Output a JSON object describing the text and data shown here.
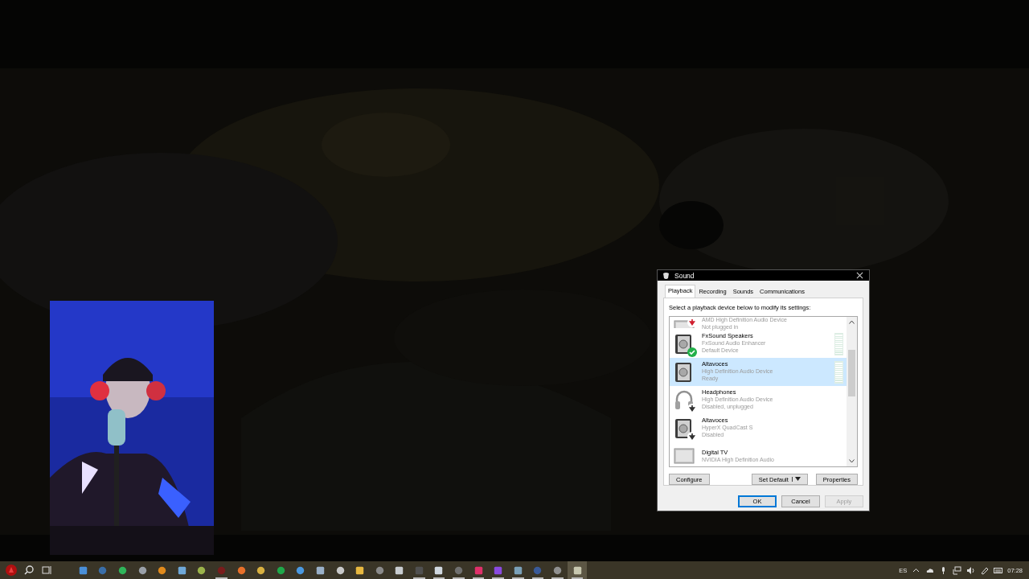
{
  "dialog": {
    "title": "Sound",
    "tabs": [
      {
        "label": "Playback",
        "selected": true
      },
      {
        "label": "Recording",
        "selected": false
      },
      {
        "label": "Sounds",
        "selected": false
      },
      {
        "label": "Communications",
        "selected": false
      }
    ],
    "instruction": "Select a playback device below to modify its settings:",
    "devices": [
      {
        "kind": "monitor",
        "description": "AMD High Definition Audio Device",
        "status": "Not plugged in",
        "is_default": false,
        "unplugged": true,
        "disabled": false,
        "selected": false,
        "meter": false
      },
      {
        "kind": "speaker",
        "name": "FxSound Speakers",
        "description": "FxSound Audio Enhancer",
        "status": "Default Device",
        "is_default": true,
        "unplugged": false,
        "disabled": false,
        "selected": false,
        "meter": true
      },
      {
        "kind": "speaker",
        "name": "Altavoces",
        "description": "High Definition Audio Device",
        "status": "Ready",
        "is_default": false,
        "unplugged": false,
        "disabled": false,
        "selected": true,
        "meter": true
      },
      {
        "kind": "headphones",
        "name": "Headphones",
        "description": "High Definition Audio Device",
        "status": "Disabled, unplugged",
        "is_default": false,
        "unplugged": false,
        "disabled": true,
        "selected": false,
        "meter": false
      },
      {
        "kind": "speaker",
        "name": "Altavoces",
        "description": "HyperX QuadCast S",
        "status": "Disabled",
        "is_default": false,
        "unplugged": false,
        "disabled": true,
        "selected": false,
        "meter": false
      },
      {
        "kind": "monitor",
        "name": "Digital TV",
        "description": "NVIDIA High Definition Audio",
        "is_default": false,
        "unplugged": false,
        "disabled": false,
        "selected": false,
        "meter": false
      }
    ],
    "buttons": [
      {
        "label": "Configure",
        "disabled": false
      },
      {
        "label": "Set Default",
        "disabled": false,
        "dropdown": true
      },
      {
        "label": "Properties",
        "disabled": false
      }
    ],
    "footer_buttons": [
      {
        "label": "OK",
        "disabled": false,
        "selected": true
      },
      {
        "label": "Cancel",
        "disabled": false,
        "selected": false
      },
      {
        "label": "Apply",
        "disabled": true,
        "selected": false
      }
    ]
  },
  "taskbar": {
    "apps": [
      {
        "kind": "square",
        "color": "#4a8fd8",
        "running": false,
        "selected": false
      },
      {
        "kind": "circle",
        "color": "#3a6ea8",
        "running": false,
        "selected": false
      },
      {
        "kind": "circle",
        "color": "#2fb55a",
        "running": false,
        "selected": false
      },
      {
        "kind": "circle",
        "color": "#9aa0a8",
        "running": false,
        "selected": false
      },
      {
        "kind": "circle",
        "color": "#e08a1c",
        "running": false,
        "selected": false
      },
      {
        "kind": "square",
        "color": "#6fa8d8",
        "running": false,
        "selected": false
      },
      {
        "kind": "circle",
        "color": "#9bb34a",
        "running": false,
        "selected": false
      },
      {
        "kind": "circle",
        "color": "#7a1c1c",
        "running": true,
        "selected": false
      },
      {
        "kind": "circle",
        "color": "#e8702a",
        "running": false,
        "selected": false
      },
      {
        "kind": "circle",
        "color": "#d8b040",
        "running": false,
        "selected": false
      },
      {
        "kind": "circle",
        "color": "#1fa84a",
        "running": false,
        "selected": false
      },
      {
        "kind": "circle",
        "color": "#4a98e0",
        "running": false,
        "selected": false
      },
      {
        "kind": "square",
        "color": "#9ab0c8",
        "running": false,
        "selected": false
      },
      {
        "kind": "circle",
        "color": "#c8c8c8",
        "running": false,
        "selected": false
      },
      {
        "kind": "square",
        "color": "#e8b840",
        "running": false,
        "selected": false
      },
      {
        "kind": "circle",
        "color": "#8a8a8a",
        "running": false,
        "selected": false
      },
      {
        "kind": "square",
        "color": "#c8ccd0",
        "running": false,
        "selected": false
      },
      {
        "kind": "square",
        "color": "#505050",
        "running": true,
        "selected": false
      },
      {
        "kind": "square",
        "color": "#d0d8e0",
        "running": true,
        "selected": false
      },
      {
        "kind": "circle",
        "color": "#707070",
        "running": true,
        "selected": false
      },
      {
        "kind": "square",
        "color": "#e0306a",
        "running": true,
        "selected": false
      },
      {
        "kind": "square",
        "color": "#8a4ae0",
        "running": true,
        "selected": false
      },
      {
        "kind": "square",
        "color": "#7aa0b8",
        "running": true,
        "selected": false
      },
      {
        "kind": "circle",
        "color": "#3a5a98",
        "running": true,
        "selected": false
      },
      {
        "kind": "circle",
        "color": "#909090",
        "running": true,
        "selected": false
      },
      {
        "kind": "square",
        "color": "#c8c8b0",
        "running": true,
        "selected": true
      }
    ],
    "language": "ES",
    "clock": "07:28"
  }
}
